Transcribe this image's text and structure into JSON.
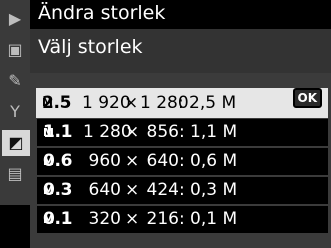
{
  "sidebar": {
    "icons": [
      {
        "name": "playback-icon",
        "glyph": "▶"
      },
      {
        "name": "camera-icon",
        "glyph": "▣"
      },
      {
        "name": "pencil-icon",
        "glyph": "✎"
      },
      {
        "name": "wrench-icon",
        "glyph": "Y"
      },
      {
        "name": "retouch-icon",
        "glyph": "◩"
      },
      {
        "name": "list-icon",
        "glyph": "▤"
      }
    ],
    "active_index": 4
  },
  "header": {
    "title": "Ändra storlek",
    "subtitle": "Välj storlek"
  },
  "options": [
    {
      "mp": "2.5",
      "unit": "M",
      "width": "1 920",
      "times": "×",
      "height": "1 280",
      "label": "2,5 M",
      "selected": true
    },
    {
      "mp": "1.1",
      "unit": "M",
      "width": "1 280",
      "times": "×",
      "height": "856",
      "label": "1,1 M",
      "selected": false
    },
    {
      "mp": "0.6",
      "unit": "M",
      "width": "960",
      "times": "×",
      "height": "640",
      "label": "0,6 M",
      "selected": false
    },
    {
      "mp": "0.3",
      "unit": "M",
      "width": "640",
      "times": "×",
      "height": "424",
      "label": "0,3 M",
      "selected": false
    },
    {
      "mp": "0.1",
      "unit": "M",
      "width": "320",
      "times": "×",
      "height": "216",
      "label": "0,1 M",
      "selected": false
    }
  ],
  "ok_label": "OK",
  "colors": {
    "selected_bg": "#e6e6e6",
    "row_bg": "#000000",
    "panel_bg": "#3b3b3b"
  }
}
